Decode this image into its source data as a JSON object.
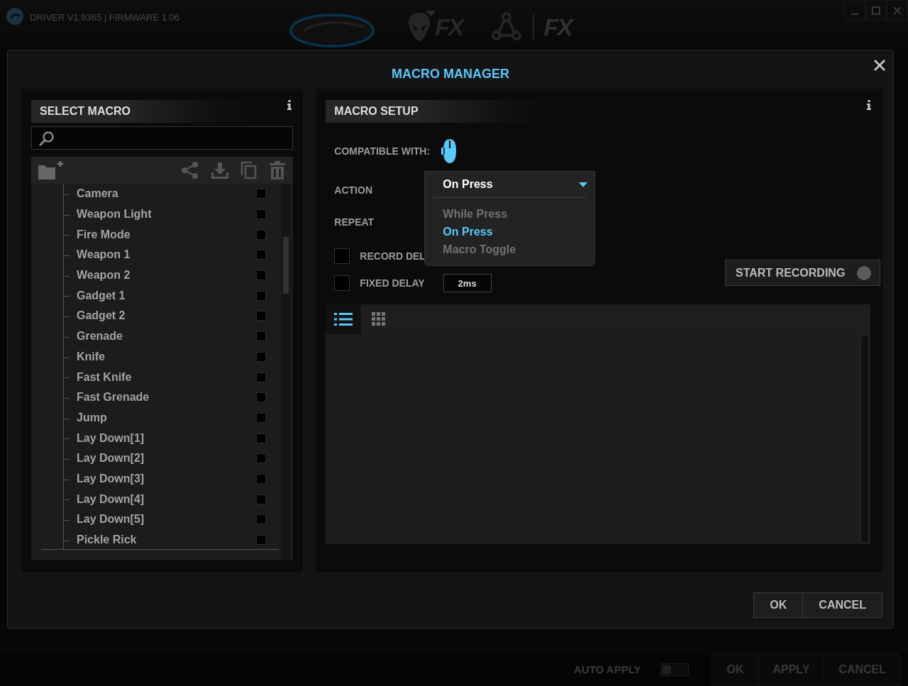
{
  "app": {
    "title": "DRIVER V1.9365 | FIRMWARE 1.06",
    "nav": [
      {
        "kind": "mouse"
      },
      {
        "kind": "alien",
        "label": "FX"
      },
      {
        "kind": "network",
        "label": "FX"
      }
    ]
  },
  "dialog": {
    "title": "MACRO MANAGER",
    "select_macro": {
      "title": "SELECT MACRO",
      "macros": [
        {
          "name": "Camera",
          "checked": false
        },
        {
          "name": "Weapon Light",
          "checked": false
        },
        {
          "name": "Fire Mode",
          "checked": false
        },
        {
          "name": "Weapon 1",
          "checked": false
        },
        {
          "name": "Weapon 2",
          "checked": false
        },
        {
          "name": "Gadget 1",
          "checked": false
        },
        {
          "name": "Gadget 2",
          "checked": false
        },
        {
          "name": "Grenade",
          "checked": false
        },
        {
          "name": "Knife",
          "checked": false
        },
        {
          "name": "Fast Knife",
          "checked": false
        },
        {
          "name": "Fast Grenade",
          "checked": false
        },
        {
          "name": "Jump",
          "checked": false
        },
        {
          "name": "Lay Down[1]",
          "checked": false
        },
        {
          "name": "Lay Down[2]",
          "checked": false
        },
        {
          "name": "Lay Down[3]",
          "checked": false
        },
        {
          "name": "Lay Down[4]",
          "checked": false
        },
        {
          "name": "Lay Down[5]",
          "checked": false
        },
        {
          "name": "Pickle Rick",
          "checked": false
        }
      ]
    },
    "macro_setup": {
      "title": "MACRO SETUP",
      "compatible_label": "COMPATIBLE WITH:",
      "action": {
        "label": "ACTION",
        "value": "On Press",
        "expanded": true,
        "options": [
          {
            "label": "While Press",
            "selected": false
          },
          {
            "label": "On Press",
            "selected": true
          },
          {
            "label": "Macro Toggle",
            "selected": false
          }
        ]
      },
      "repeat_label": "REPEAT",
      "record_delay": {
        "label": "RECORD DEL",
        "checked": false
      },
      "fixed_delay": {
        "label": "FIXED DELAY",
        "checked": false,
        "value": "2ms"
      },
      "start_recording": "START RECORDING",
      "view_tabs": [
        {
          "kind": "list",
          "selected": true
        },
        {
          "kind": "grid",
          "selected": false
        }
      ]
    },
    "buttons": [
      "OK",
      "CANCEL"
    ]
  },
  "bottom_bar": {
    "auto_apply": {
      "label": "AUTO APPLY",
      "on": false
    },
    "buttons": [
      "OK",
      "APPLY",
      "CANCEL"
    ]
  }
}
